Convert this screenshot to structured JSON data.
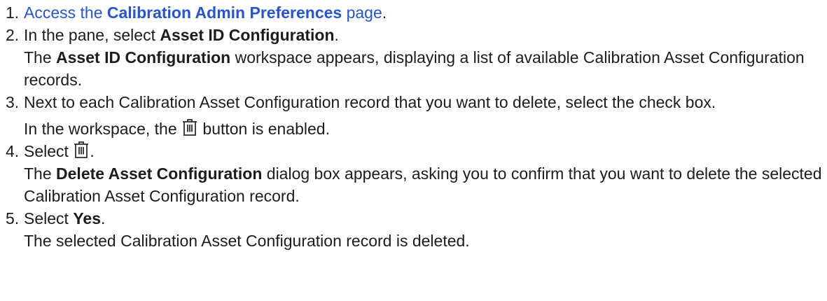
{
  "steps": [
    {
      "num": "1.",
      "link_pre": "Access the ",
      "link_bold": "Calibration Admin Preferences",
      "link_post": " page",
      "after": "."
    },
    {
      "num": "2.",
      "pre": "In the pane, select ",
      "bold": "Asset ID Configuration",
      "post": ".",
      "result_pre": "The ",
      "result_bold": "Asset ID Configuration",
      "result_post": " workspace appears, displaying a list of available Calibration Asset Configuration records."
    },
    {
      "num": "3.",
      "text": "Next to each Calibration Asset Configuration record that you want to delete, select the check box.",
      "result_pre": "In the workspace, the ",
      "result_post": " button is enabled."
    },
    {
      "num": "4.",
      "pre": "Select ",
      "post": ".",
      "result_pre": "The ",
      "result_bold": "Delete Asset Configuration",
      "result_post": " dialog box appears, asking you to confirm that you want to delete the selected Calibration Asset Configuration record."
    },
    {
      "num": "5.",
      "pre": "Select ",
      "bold": "Yes",
      "post": ".",
      "result": "The selected Calibration Asset Configuration record is deleted."
    }
  ],
  "icons": {
    "delete": "trash-icon"
  },
  "colors": {
    "link": "#2554d6",
    "text": "#1c1c1c"
  }
}
